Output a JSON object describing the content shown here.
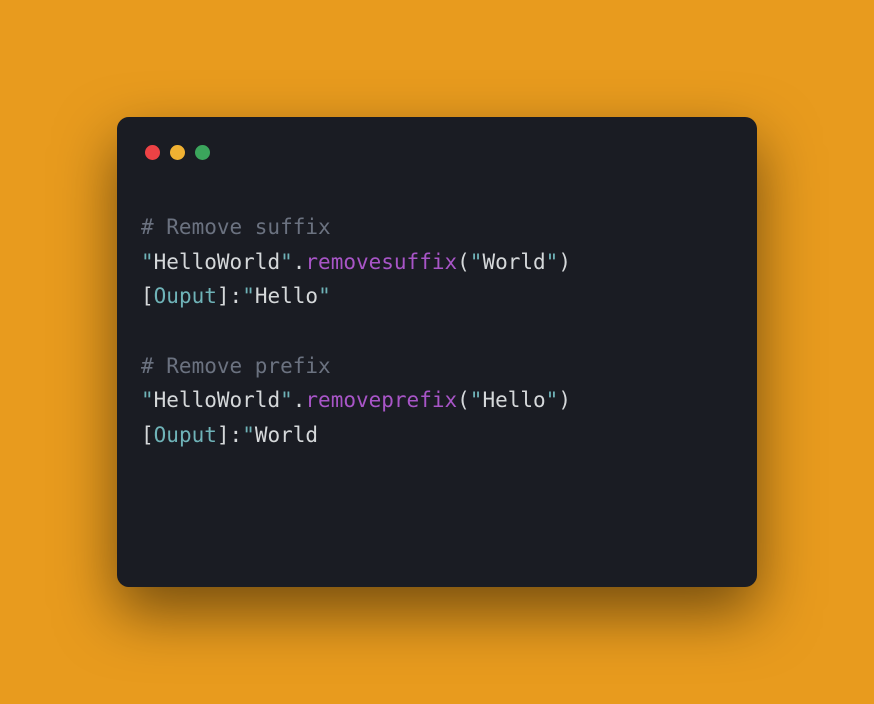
{
  "code": {
    "line1_comment": "# Remove suffix",
    "line2": {
      "str1_open": "\"",
      "str1_val": "HelloWorld",
      "str1_close": "\"",
      "dot": ".",
      "method": "removesuffix",
      "paren_open": "(",
      "arg_open": "\"",
      "arg_val": "World",
      "arg_close": "\"",
      "paren_close": ")"
    },
    "line3": {
      "bracket_open": "[",
      "label": "Ouput",
      "bracket_close": "]",
      "colon": ":",
      "result_open": "\"",
      "result_val": "Hello",
      "result_close": "\""
    },
    "line5_comment": "# Remove prefix",
    "line6": {
      "str1_open": "\"",
      "str1_val": "HelloWorld",
      "str1_close": "\"",
      "dot": ".",
      "method": "removeprefix",
      "paren_open": "(",
      "arg_open": "\"",
      "arg_val": "Hello",
      "arg_close": "\"",
      "paren_close": ")"
    },
    "line7": {
      "bracket_open": "[",
      "label": "Ouput",
      "bracket_close": "]",
      "colon": ":",
      "result_open": "\"",
      "result_val": "World"
    }
  }
}
